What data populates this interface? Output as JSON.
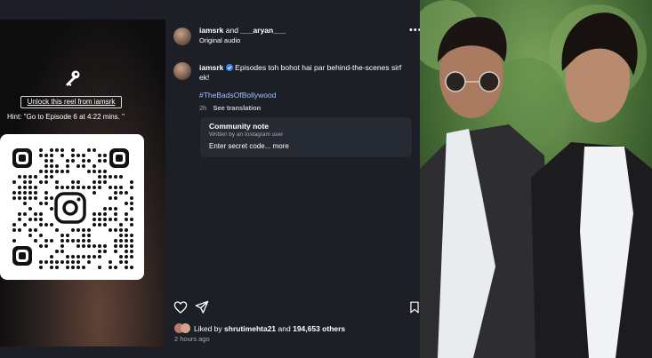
{
  "header": {
    "author_1": "iamsrk",
    "and_word": "and",
    "author_2": "___aryan___",
    "audio": "Original audio"
  },
  "caption": {
    "author": "iamsrk",
    "text_line1": "Episodes toh bohot hai par behind-the-scenes sirf",
    "text_line2": "ek!",
    "hashtag": "#TheBadsOfBollywood",
    "age": "2h",
    "see_translation": "See translation"
  },
  "community_note": {
    "title": "Community note",
    "subtitle": "Written by an Instagram user",
    "body": "Enter secret code...",
    "more": "more"
  },
  "reel": {
    "unlock_label": "Unlock this reel from iamsrk",
    "hint": "Hint: \"Go to Episode 6 at 4:22 mins. \""
  },
  "likes": {
    "prefix": "Liked by",
    "user": "shrutimehta21",
    "and_word": "and",
    "count": "194,653 others",
    "time": "2 hours ago"
  },
  "icons": [
    "key-icon",
    "more-icon",
    "verified-icon",
    "heart-icon",
    "share-icon",
    "save-icon",
    "instagram-icon"
  ],
  "colors": {
    "verified": "#3b82f6",
    "hashtag": "#9ec3ff",
    "panel": "#1c1f26"
  }
}
